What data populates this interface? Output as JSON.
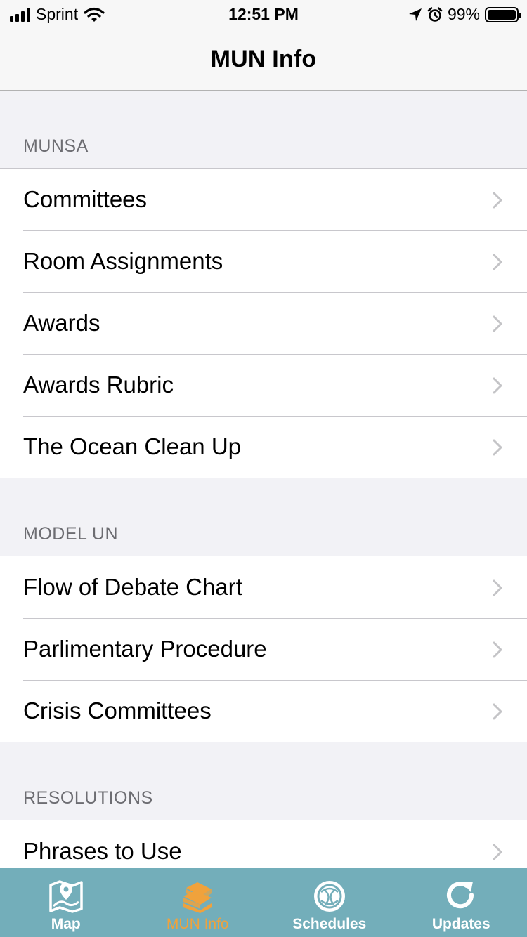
{
  "status_bar": {
    "carrier": "Sprint",
    "time": "12:51 PM",
    "battery_percent": "99%",
    "icons": [
      "signal-icon",
      "wifi-icon",
      "location-arrow-icon",
      "alarm-icon",
      "battery-icon"
    ]
  },
  "nav": {
    "title": "MUN Info"
  },
  "sections": [
    {
      "header": "MUNSA",
      "items": [
        "Committees",
        "Room Assignments",
        "Awards",
        "Awards Rubric",
        "The Ocean Clean Up"
      ]
    },
    {
      "header": "MODEL UN",
      "items": [
        "Flow of Debate Chart",
        "Parlimentary Procedure",
        "Crisis Committees"
      ]
    },
    {
      "header": "RESOLUTIONS",
      "items": [
        "Phrases to Use"
      ]
    }
  ],
  "tabs": [
    {
      "label": "Map",
      "icon": "map-icon",
      "active": false
    },
    {
      "label": "MUN Info",
      "icon": "books-icon",
      "active": true
    },
    {
      "label": "Schedules",
      "icon": "globe-emblem-icon",
      "active": false
    },
    {
      "label": "Updates",
      "icon": "refresh-icon",
      "active": false
    }
  ],
  "colors": {
    "tab_bar_bg": "#73aeba",
    "tab_active": "#f0a23c",
    "tab_inactive": "#ffffff",
    "grouped_bg": "#f2f2f6"
  }
}
